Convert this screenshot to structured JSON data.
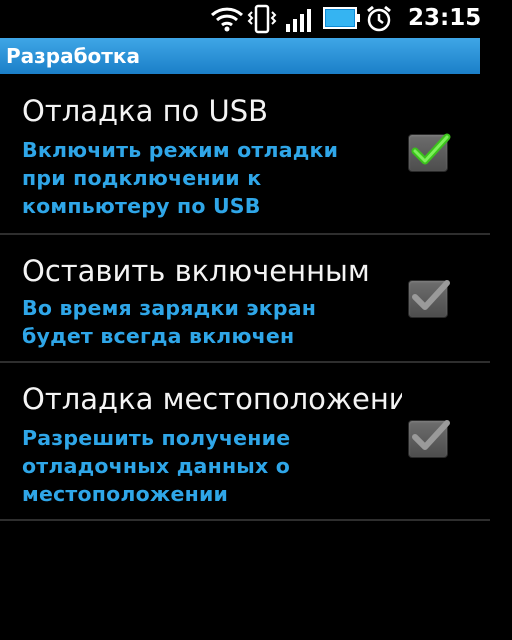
{
  "status_bar": {
    "time": "23:15",
    "icons": [
      "wifi-icon",
      "vibrate-icon",
      "signal-icon",
      "battery-icon",
      "alarm-icon"
    ]
  },
  "title": "Разработка",
  "preferences": [
    {
      "title": "Отладка по USB",
      "summary_lines": [
        "Включить режим отладки",
        "при подключении к",
        "компьютеру по USB"
      ],
      "checked": true,
      "check_color": "#4dd52a"
    },
    {
      "title": "Оставить включенным",
      "summary_lines": [
        "Во время зарядки экран",
        "будет всегда включен"
      ],
      "checked": true,
      "check_color": "#9a9a9a"
    },
    {
      "title": "Отладка местоположения",
      "summary_lines": [
        "Разрешить получение",
        "отладочных данных о",
        "местоположении"
      ],
      "checked": true,
      "check_color": "#9a9a9a"
    }
  ],
  "colors": {
    "accent": "#2fa6e8",
    "title_bar": "#1b7fc8",
    "background": "#000000"
  }
}
